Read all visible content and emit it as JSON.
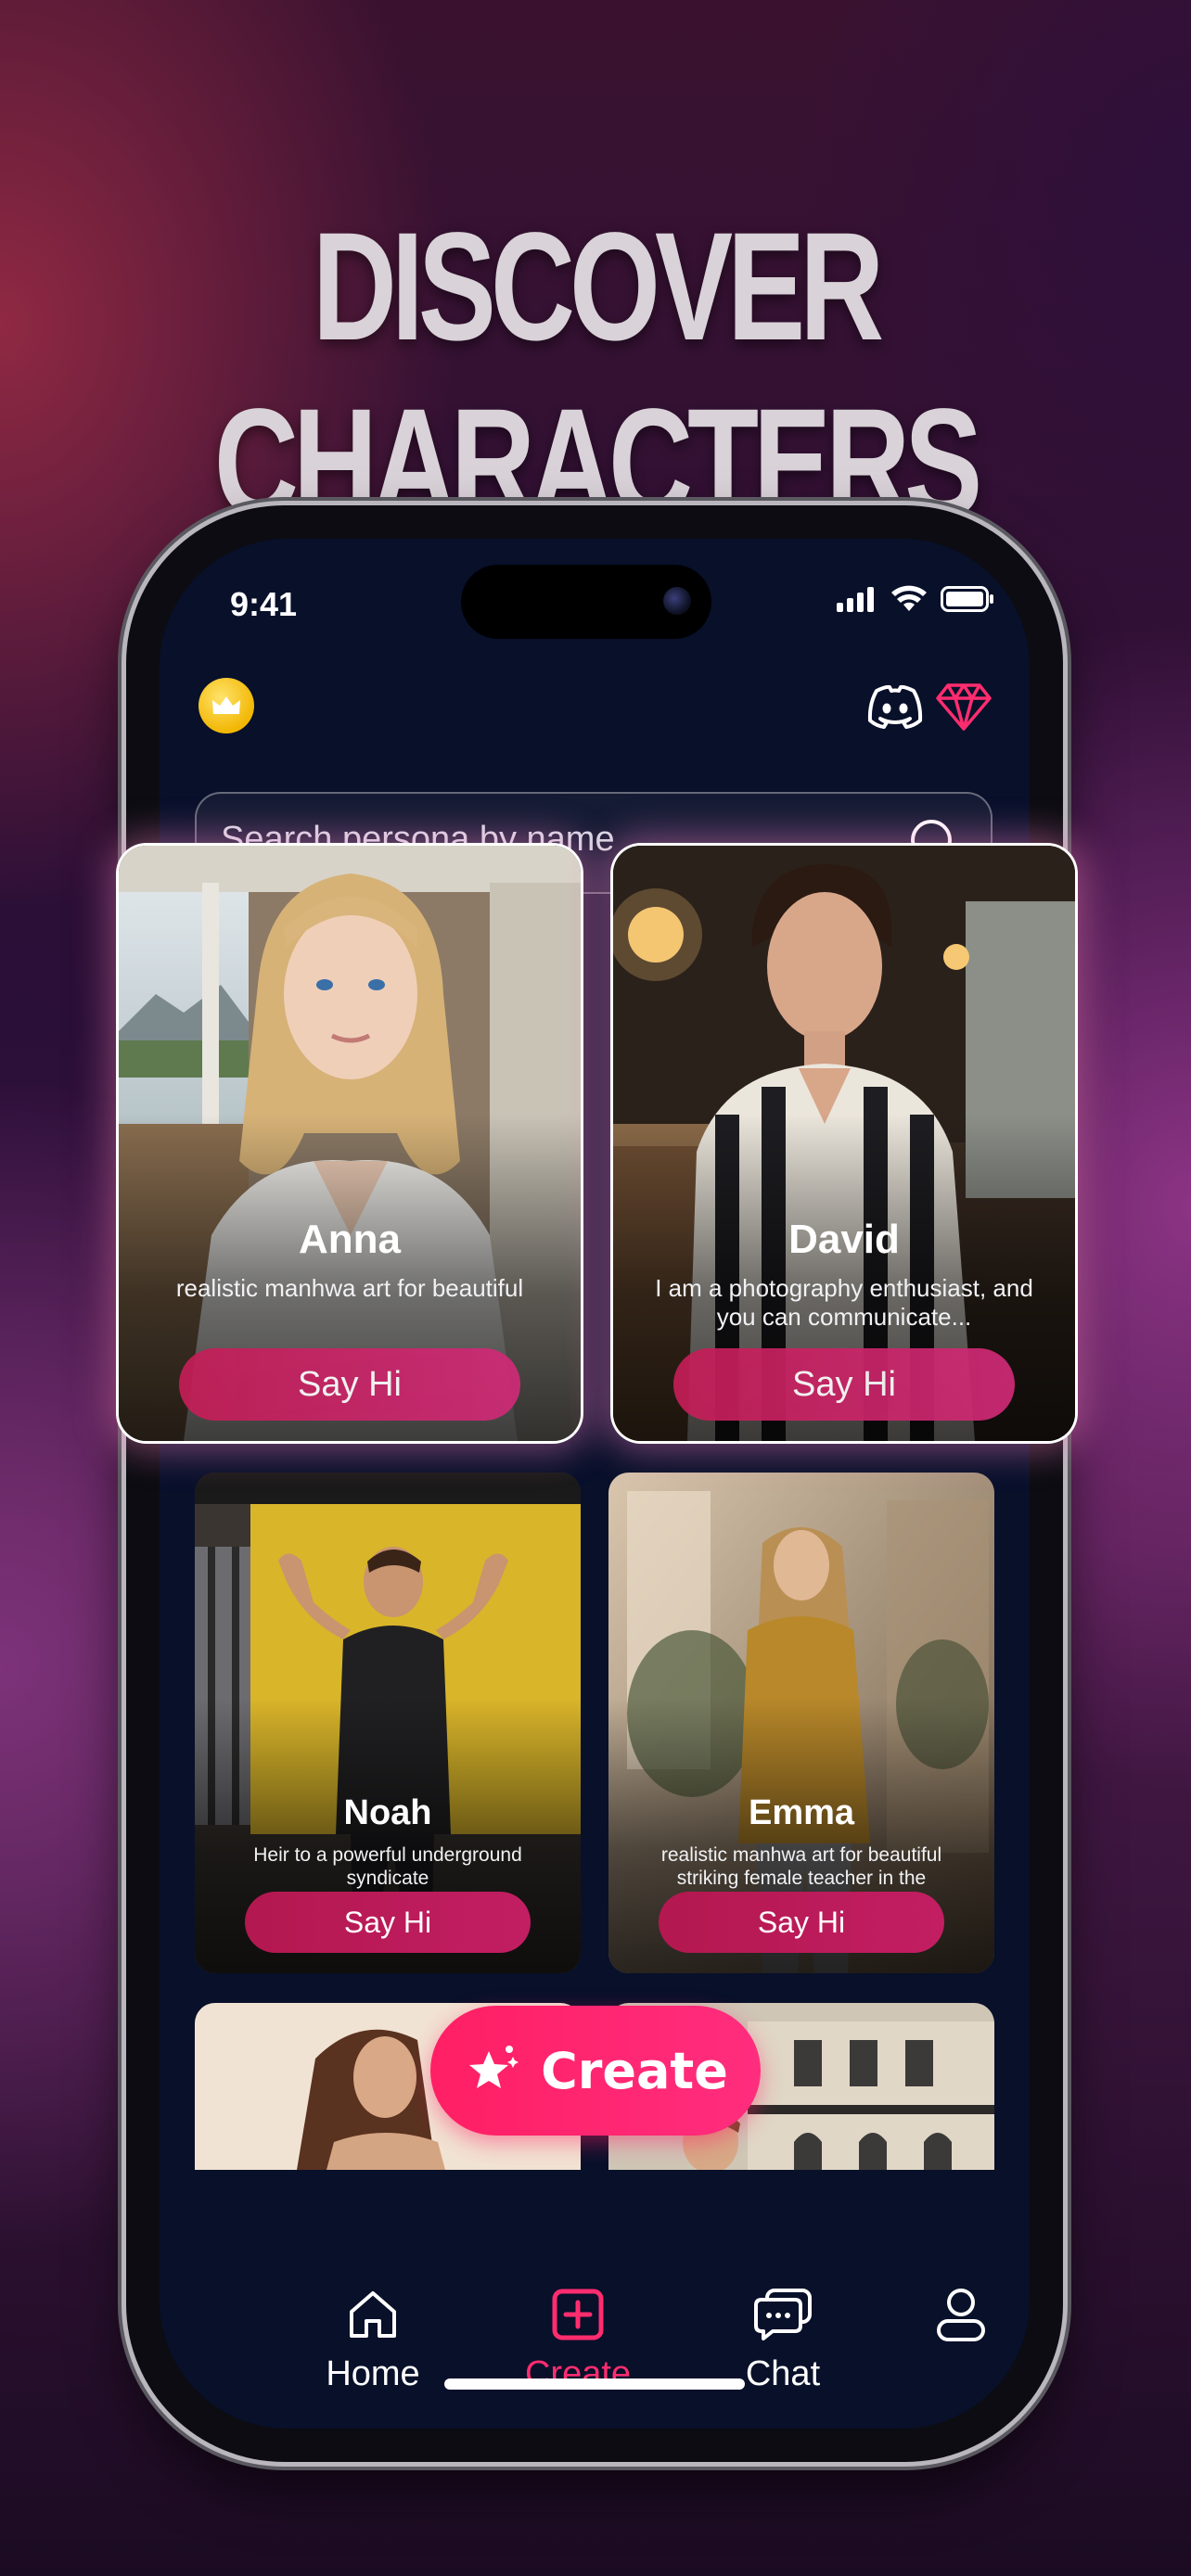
{
  "headline": "DISCOVER CHARACTERS",
  "status_bar": {
    "time": "9:41"
  },
  "search": {
    "placeholder": "Search persona by name"
  },
  "characters": [
    {
      "name": "Anna",
      "description": "realistic manhwa art for beautiful",
      "button": "Say Hi"
    },
    {
      "name": "David",
      "description": "I am a photography enthusiast, and you can communicate...",
      "button": "Say Hi"
    },
    {
      "name": "Noah",
      "description": "Heir to a powerful underground syndicate",
      "button": "Say Hi"
    },
    {
      "name": "Emma",
      "description": "realistic manhwa art for beautiful striking female teacher in the",
      "button": "Say Hi"
    }
  ],
  "create_button": "Create",
  "tab_bar": {
    "items": [
      {
        "label": "Home",
        "icon": "home-icon"
      },
      {
        "label": "Create",
        "icon": "plus-square-icon",
        "active": true
      },
      {
        "label": "Chat",
        "icon": "chat-bubbles-icon"
      },
      {
        "label": "",
        "icon": "profile-icon"
      }
    ]
  },
  "colors": {
    "accent": "#ff2d6f",
    "say_hi": "#c21e63",
    "background": "#08102a"
  }
}
